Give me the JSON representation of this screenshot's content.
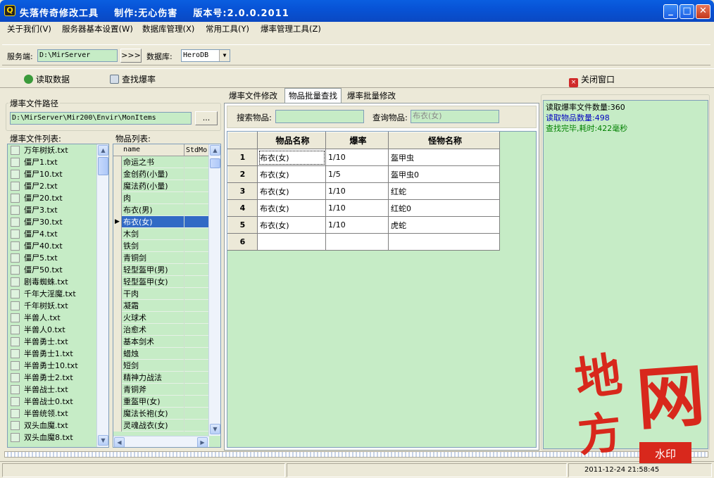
{
  "window": {
    "icon": "Q",
    "title": "失落传奇修改工具    制作:无心伤害    版本号:2.0.0.2011",
    "min": "_",
    "max": "□",
    "close": "✕"
  },
  "menu": [
    "关于我们(V)",
    "服务器基本设置(W)",
    "数据库管理(X)",
    "常用工具(Y)",
    "爆率管理工具(Z)"
  ],
  "toolbar": {
    "server_label": "服务端:",
    "server_value": "D:\\MirServer",
    "browse_label": ">>>",
    "db_label": "数据库:",
    "db_value": "HeroDB"
  },
  "actions": {
    "read": "读取数据",
    "find": "查找爆率",
    "close": "关闭窗口"
  },
  "left": {
    "path_group": "爆率文件路径",
    "path_value": "D:\\MirServer\\Mir200\\Envir\\MonItems",
    "path_btn": "...",
    "files_label": "爆率文件列表:",
    "items_label": "物品列表:",
    "col_name": "name",
    "col_std": "StdMo"
  },
  "files": [
    "万年树妖.txt",
    "僵尸1.txt",
    "僵尸10.txt",
    "僵尸2.txt",
    "僵尸20.txt",
    "僵尸3.txt",
    "僵尸30.txt",
    "僵尸4.txt",
    "僵尸40.txt",
    "僵尸5.txt",
    "僵尸50.txt",
    "剧毒蜘蛛.txt",
    "千年大淫魔.txt",
    "千年树妖.txt",
    "半兽人.txt",
    "半兽人0.txt",
    "半兽勇士.txt",
    "半兽勇士1.txt",
    "半兽勇士10.txt",
    "半兽勇士2.txt",
    "半兽战士.txt",
    "半兽战士0.txt",
    "半兽统领.txt",
    "双头血魔.txt",
    "双头血魔8.txt"
  ],
  "items": [
    "命运之书",
    "金创药(小量)",
    "魔法药(小量)",
    "肉",
    "布衣(男)",
    "布衣(女)",
    "木剑",
    "铁剑",
    "青铜剑",
    "轻型盔甲(男)",
    "轻型盔甲(女)",
    "干肉",
    "凝霜",
    "火球术",
    "治愈术",
    "基本剑术",
    "蜡烛",
    "短剑",
    "精神力战法",
    "青铜斧",
    "重盔甲(女)",
    "魔法长袍(女)",
    "灵魂战衣(女)"
  ],
  "tabs": [
    "爆率文件修改",
    "物品批量查找",
    "爆率批量修改"
  ],
  "search": {
    "item_label": "搜索物品:",
    "item_value": "",
    "query_label": "查询物品:",
    "query_value": "布衣(女)"
  },
  "grid": {
    "headers": [
      "物品名称",
      "爆率",
      "怪物名称"
    ],
    "rows": [
      [
        "1",
        "布衣(女)",
        "1/10",
        "盔甲虫"
      ],
      [
        "2",
        "布衣(女)",
        "1/5",
        "盔甲虫0"
      ],
      [
        "3",
        "布衣(女)",
        "1/10",
        "红蛇"
      ],
      [
        "4",
        "布衣(女)",
        "1/10",
        "红蛇0"
      ],
      [
        "5",
        "布衣(女)",
        "1/10",
        "虎蛇"
      ],
      [
        "6",
        "",
        "",
        ""
      ]
    ]
  },
  "log": [
    "读取爆率文件数量:360",
    "读取物品数量:498",
    "查找完毕,耗时:422毫秒"
  ],
  "status": {
    "time": "2011-12-24 21:58:45"
  },
  "watermark": {
    "chars": [
      "地",
      "方",
      "网"
    ],
    "stamp": "水印"
  },
  "colors": {
    "list_bg": "#c6ecc6",
    "title_blue": "#0853d6",
    "watermark_red": "#d8281c",
    "log_blue": "#0000c0",
    "log_green": "#008000"
  }
}
